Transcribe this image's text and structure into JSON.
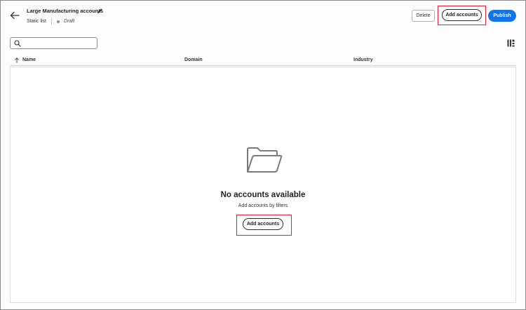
{
  "header": {
    "title": "Large Manufacturing accounts",
    "list_type": "Static list",
    "status": "Draft"
  },
  "toolbar": {
    "delete_label": "Delete",
    "add_accounts_label": "Add accounts",
    "publish_label": "Publish"
  },
  "search": {
    "value": "",
    "placeholder": ""
  },
  "table": {
    "columns": [
      "Name",
      "Domain",
      "Industry"
    ],
    "sort_column": "Name",
    "rows": []
  },
  "empty_state": {
    "title": "No accounts available",
    "subtitle": "Add accounts by filters",
    "button_label": "Add accounts"
  },
  "colors": {
    "accent": "#1473e6",
    "highlight": "#e0242f"
  },
  "icons": [
    "back-arrow-icon",
    "pencil-icon",
    "search-icon",
    "column-settings-icon",
    "sort-arrow-icon",
    "folder-icon"
  ]
}
